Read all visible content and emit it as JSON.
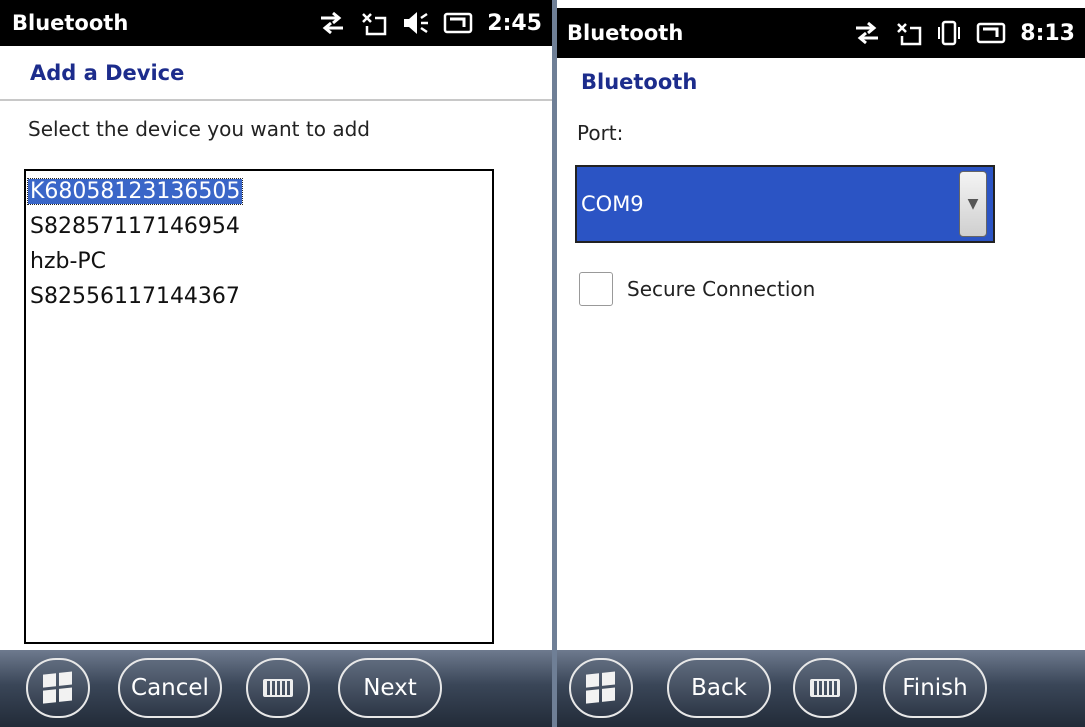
{
  "left_screen": {
    "status": {
      "title": "Bluetooth",
      "time": "2:45"
    },
    "page_title": "Add a Device",
    "instruction": "Select the device you want to add",
    "devices": [
      "K68058123136505",
      "S82857117146954",
      "hzb-PC",
      "S82556117144367"
    ],
    "selected_device": "K68058123136505",
    "buttons": {
      "cancel": "Cancel",
      "next": "Next"
    }
  },
  "right_screen": {
    "status": {
      "title": "Bluetooth",
      "time": "8:13"
    },
    "page_title": "Bluetooth",
    "port_label": "Port:",
    "port_value": "COM9",
    "secure_label": "Secure Connection",
    "secure_checked": false,
    "buttons": {
      "back": "Back",
      "finish": "Finish"
    }
  },
  "icons": [
    "sync-icon",
    "no-signal-icon",
    "speaker-icon",
    "vibrate-icon",
    "battery-icon",
    "windows-start-icon",
    "keyboard-icon"
  ],
  "colors": {
    "accent": "#1c2c8c",
    "selection": "#3a66c8",
    "combo": "#2b54c4"
  }
}
